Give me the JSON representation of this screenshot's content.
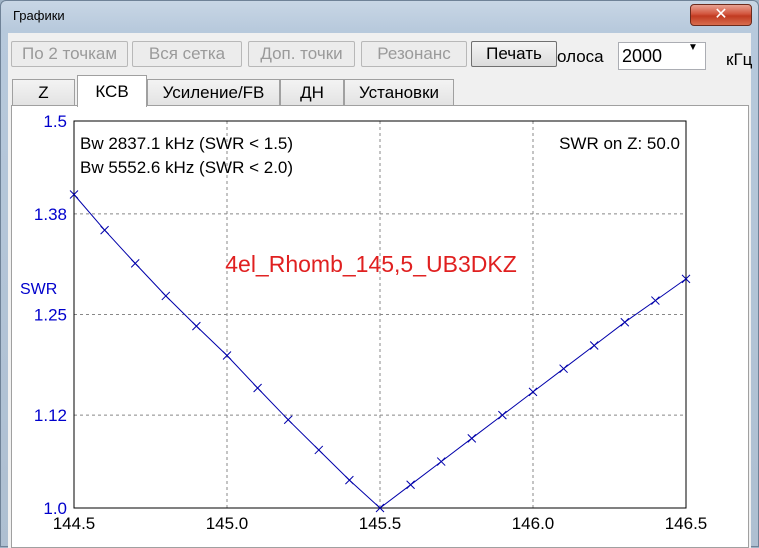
{
  "window": {
    "title": "Графики",
    "close_glyph": "✕"
  },
  "toolbar": {
    "buttons": [
      {
        "label": "По 2 точкам",
        "enabled": false
      },
      {
        "label": "Вся сетка",
        "enabled": false
      },
      {
        "label": "Доп. точки",
        "enabled": false
      },
      {
        "label": "Резонанс",
        "enabled": false
      },
      {
        "label": "Печать",
        "enabled": true
      }
    ],
    "band_label": "олоса",
    "band_value": "2000",
    "band_unit": "кГц"
  },
  "tabs": [
    {
      "label": "Z",
      "selected": false
    },
    {
      "label": "КСВ",
      "selected": true
    },
    {
      "label": "Усиление/FB",
      "selected": false
    },
    {
      "label": "ДН",
      "selected": false
    },
    {
      "label": "Установки",
      "selected": false
    }
  ],
  "colors": {
    "axis_text": "#0000cc",
    "curve": "#0000aa",
    "watermark": "#e02020",
    "grid": "#888888"
  },
  "chart_data": {
    "type": "line",
    "ylabel": "SWR",
    "xlim": [
      144.5,
      146.5
    ],
    "ylim": [
      1.0,
      1.5
    ],
    "x_ticks": [
      "144.5",
      "145.0",
      "145.5",
      "146.0",
      "146.5"
    ],
    "y_ticks": [
      "1.0",
      "1.12",
      "1.25",
      "1.38",
      "1.5"
    ],
    "grid": true,
    "annotations": {
      "bw1": "Bw 2837.1 kHz (SWR < 1.5)",
      "bw2": "Bw 5552.6 kHz (SWR < 2.0)",
      "swr_on_z": "SWR on Z: 50.0",
      "watermark": "4el_Rhomb_145,5_UB3DKZ"
    },
    "series": [
      {
        "x": [
          144.5,
          144.6,
          144.7,
          144.8,
          144.9,
          145.0,
          145.1,
          145.2,
          145.3,
          145.4,
          145.5,
          145.6,
          145.7,
          145.8,
          145.9,
          146.0,
          146.1,
          146.2,
          146.3,
          146.4,
          146.5
        ],
        "values": [
          1.405,
          1.359,
          1.316,
          1.274,
          1.235,
          1.197,
          1.155,
          1.114,
          1.075,
          1.036,
          1.0,
          1.03,
          1.06,
          1.09,
          1.12,
          1.15,
          1.18,
          1.21,
          1.24,
          1.268,
          1.296
        ]
      }
    ]
  }
}
